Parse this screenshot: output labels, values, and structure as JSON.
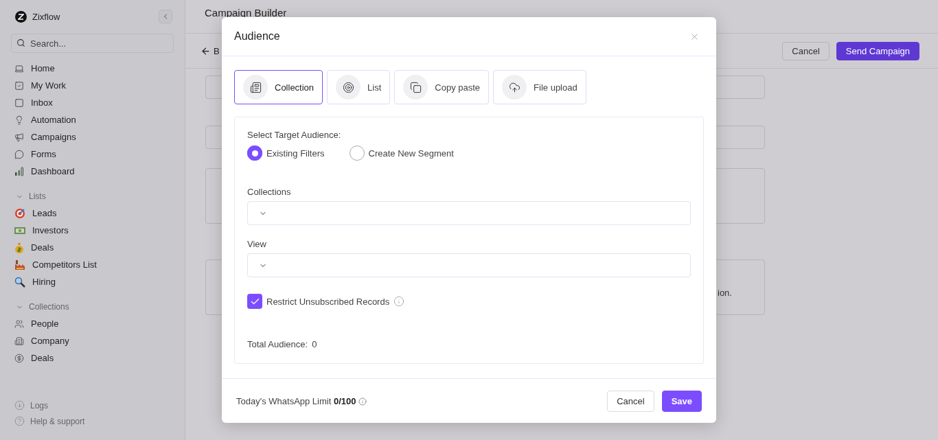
{
  "sidebar": {
    "brand": "Zixflow",
    "search": {
      "placeholder": "Search..."
    },
    "nav": [
      {
        "label": "Home"
      },
      {
        "label": "My Work"
      },
      {
        "label": "Inbox"
      },
      {
        "label": "Automation"
      },
      {
        "label": "Campaigns"
      },
      {
        "label": "Forms"
      },
      {
        "label": "Dashboard"
      }
    ],
    "sections": [
      {
        "title": "Lists",
        "expanded": true,
        "items": [
          {
            "label": "Leads"
          },
          {
            "label": "Investors"
          },
          {
            "label": "Deals"
          },
          {
            "label": "Competitors List"
          },
          {
            "label": "Hiring"
          }
        ]
      },
      {
        "title": "Collections",
        "expanded": true,
        "items": [
          {
            "label": "People"
          },
          {
            "label": "Company"
          },
          {
            "label": "Deals"
          }
        ]
      }
    ],
    "footer": [
      {
        "label": "Logs"
      },
      {
        "label": "Help & support"
      }
    ]
  },
  "page": {
    "title": "Campaign Builder",
    "back_label": "B",
    "buttons": [
      {
        "label": "Cancel",
        "kind": "secondary"
      },
      {
        "label": "Send Campaign",
        "kind": "primary"
      }
    ],
    "partial_text": "ion."
  },
  "modal": {
    "title": "Audience",
    "tabs": [
      {
        "label": "Collection",
        "selected": true
      },
      {
        "label": "List",
        "selected": false
      },
      {
        "label": "Copy paste",
        "selected": false
      },
      {
        "label": "File upload",
        "selected": false
      }
    ],
    "target_label": "Select Target Audience:",
    "options": [
      {
        "label": "Existing Filters",
        "selected": true
      },
      {
        "label": "Create New Segment",
        "selected": false
      }
    ],
    "fields": [
      {
        "label": "Collections"
      },
      {
        "label": "View"
      }
    ],
    "restrict": {
      "label": "Restrict Unsubscribed Records",
      "checked": true
    },
    "total": {
      "label": "Total Audience:",
      "value": "0"
    },
    "limit": "Today's WhatsApp Limit **0/100**",
    "buttons": [
      {
        "label": "Cancel",
        "kind": "secondary"
      },
      {
        "label": "Save",
        "kind": "primary"
      }
    ]
  }
}
